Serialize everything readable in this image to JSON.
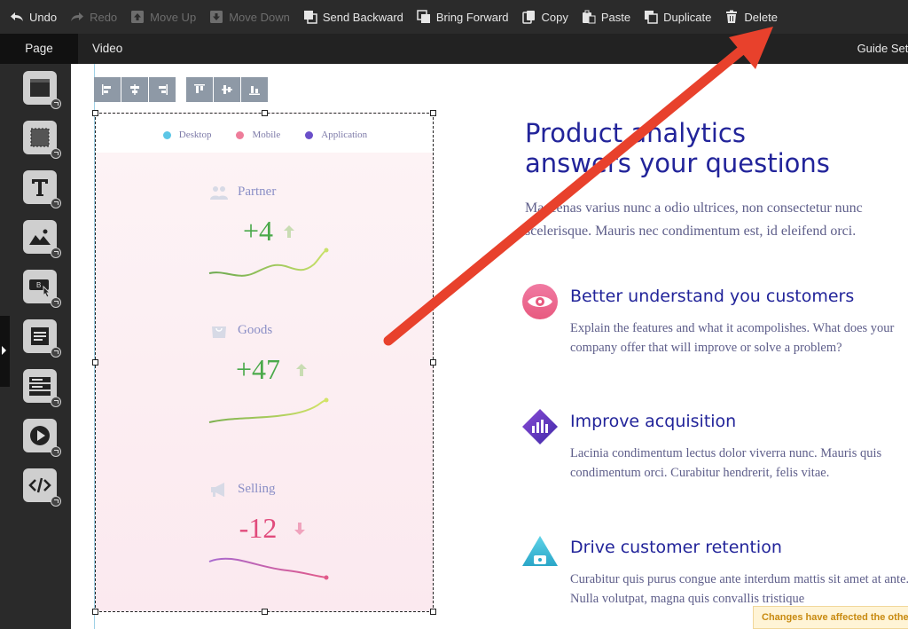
{
  "toolbar": {
    "buttons": [
      {
        "label": "Undo",
        "icon": "undo-icon",
        "enabled": true
      },
      {
        "label": "Redo",
        "icon": "redo-icon",
        "enabled": false
      },
      {
        "label": "Move Up",
        "icon": "move-up-icon",
        "enabled": false
      },
      {
        "label": "Move Down",
        "icon": "move-down-icon",
        "enabled": false
      },
      {
        "label": "Send Backward",
        "icon": "send-backward-icon",
        "enabled": true
      },
      {
        "label": "Bring Forward",
        "icon": "bring-forward-icon",
        "enabled": true
      },
      {
        "label": "Copy",
        "icon": "copy-icon",
        "enabled": true
      },
      {
        "label": "Paste",
        "icon": "paste-icon",
        "enabled": true
      },
      {
        "label": "Duplicate",
        "icon": "duplicate-icon",
        "enabled": true
      },
      {
        "label": "Delete",
        "icon": "trash-icon",
        "enabled": true
      }
    ]
  },
  "tabs": {
    "page": "Page",
    "video": "Video",
    "guide_settings": "Guide Sett"
  },
  "sidebar": {
    "tools": [
      "section-icon",
      "frame-icon",
      "text-icon",
      "image-icon",
      "button-icon",
      "form-icon",
      "list-icon",
      "video-icon",
      "code-icon"
    ]
  },
  "image_block": {
    "legend": [
      {
        "label": "Desktop",
        "color": "#5cc6e6"
      },
      {
        "label": "Mobile",
        "color": "#ee7d9a"
      },
      {
        "label": "Application",
        "color": "#6a4fc9"
      }
    ],
    "metrics": [
      {
        "label": "Partner",
        "value": "+4",
        "trend": "up",
        "color": "#4aa94a"
      },
      {
        "label": "Goods",
        "value": "+47",
        "trend": "up",
        "color": "#4aa94a"
      },
      {
        "label": "Selling",
        "value": "-12",
        "trend": "down",
        "color": "#e14b7c"
      }
    ]
  },
  "content": {
    "hero_title_line1": "Product analytics",
    "hero_title_line2": "answers your questions",
    "hero_text": "Maecenas varius nunc a odio ultrices, non consectetur nunc scelerisque. Mauris nec condimentum est, id eleifend orci.",
    "features": [
      {
        "title": "Better understand you customers",
        "text": "Explain the features and what it acompolishes. What does your company offer that will improve or solve a problem?",
        "icon": "eye-icon"
      },
      {
        "title": "Improve acquisition",
        "text": "Lacinia condimentum lectus dolor viverra nunc. Mauris quis condimentum orci. Curabitur hendrerit, felis vitae.",
        "icon": "bar-chart-diamond-icon"
      },
      {
        "title": "Drive customer retention",
        "text": "Curabitur quis purus congue ante interdum mattis sit amet at ante. Nulla volutpat, magna quis convallis tristique",
        "icon": "triangle-lock-icon"
      }
    ]
  },
  "notice": "Changes have affected the other",
  "colors": {
    "accent": "#22249a",
    "annotation_arrow": "#e8412c"
  }
}
